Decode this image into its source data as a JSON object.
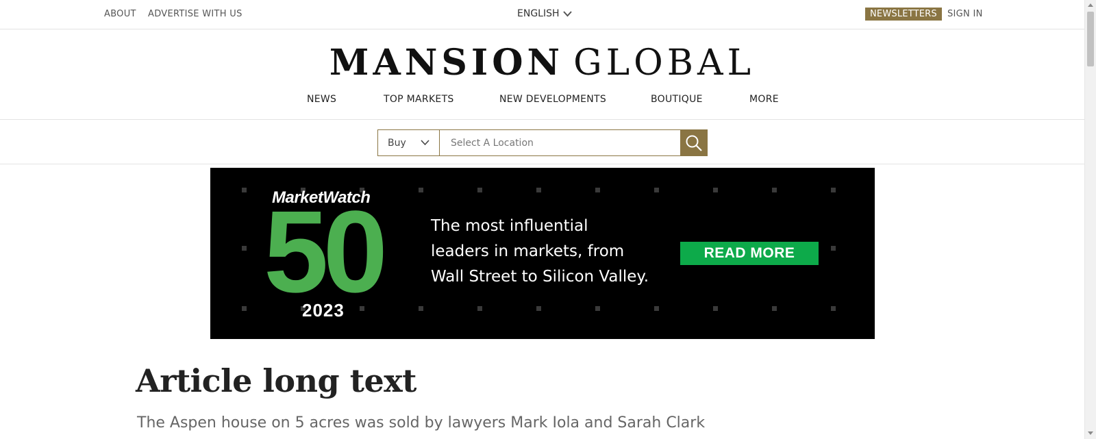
{
  "utility": {
    "about": "ABOUT",
    "advertise": "ADVERTISE WITH US",
    "language": "ENGLISH",
    "newsletters": "NEWSLETTERS",
    "signin": "SIGN IN"
  },
  "masthead": {
    "brand_strong": "MANSION",
    "brand_light": "GLOBAL"
  },
  "nav": {
    "items": [
      "NEWS",
      "TOP MARKETS",
      "NEW DEVELOPMENTS",
      "BOUTIQUE",
      "MORE"
    ]
  },
  "search": {
    "type_selected": "Buy",
    "placeholder": "Select A Location"
  },
  "banner": {
    "brand": "MarketWatch",
    "big_number": "50",
    "year": "2023",
    "copy": "The most influential leaders in markets, from Wall Street to Silicon Valley.",
    "cta": "READ MORE"
  },
  "article": {
    "title": "Article long text",
    "subtitle": "The Aspen house on 5 acres was sold by lawyers Mark Iola and Sarah Clark"
  },
  "colors": {
    "accent": "#8a7543",
    "banner_bg": "#000000",
    "banner_green": "#4caf50",
    "cta_green": "#0daa4a"
  },
  "icons": {
    "language_chevron": "chevron-down-icon",
    "type_chevron": "chevron-down-icon",
    "search": "search-icon"
  }
}
